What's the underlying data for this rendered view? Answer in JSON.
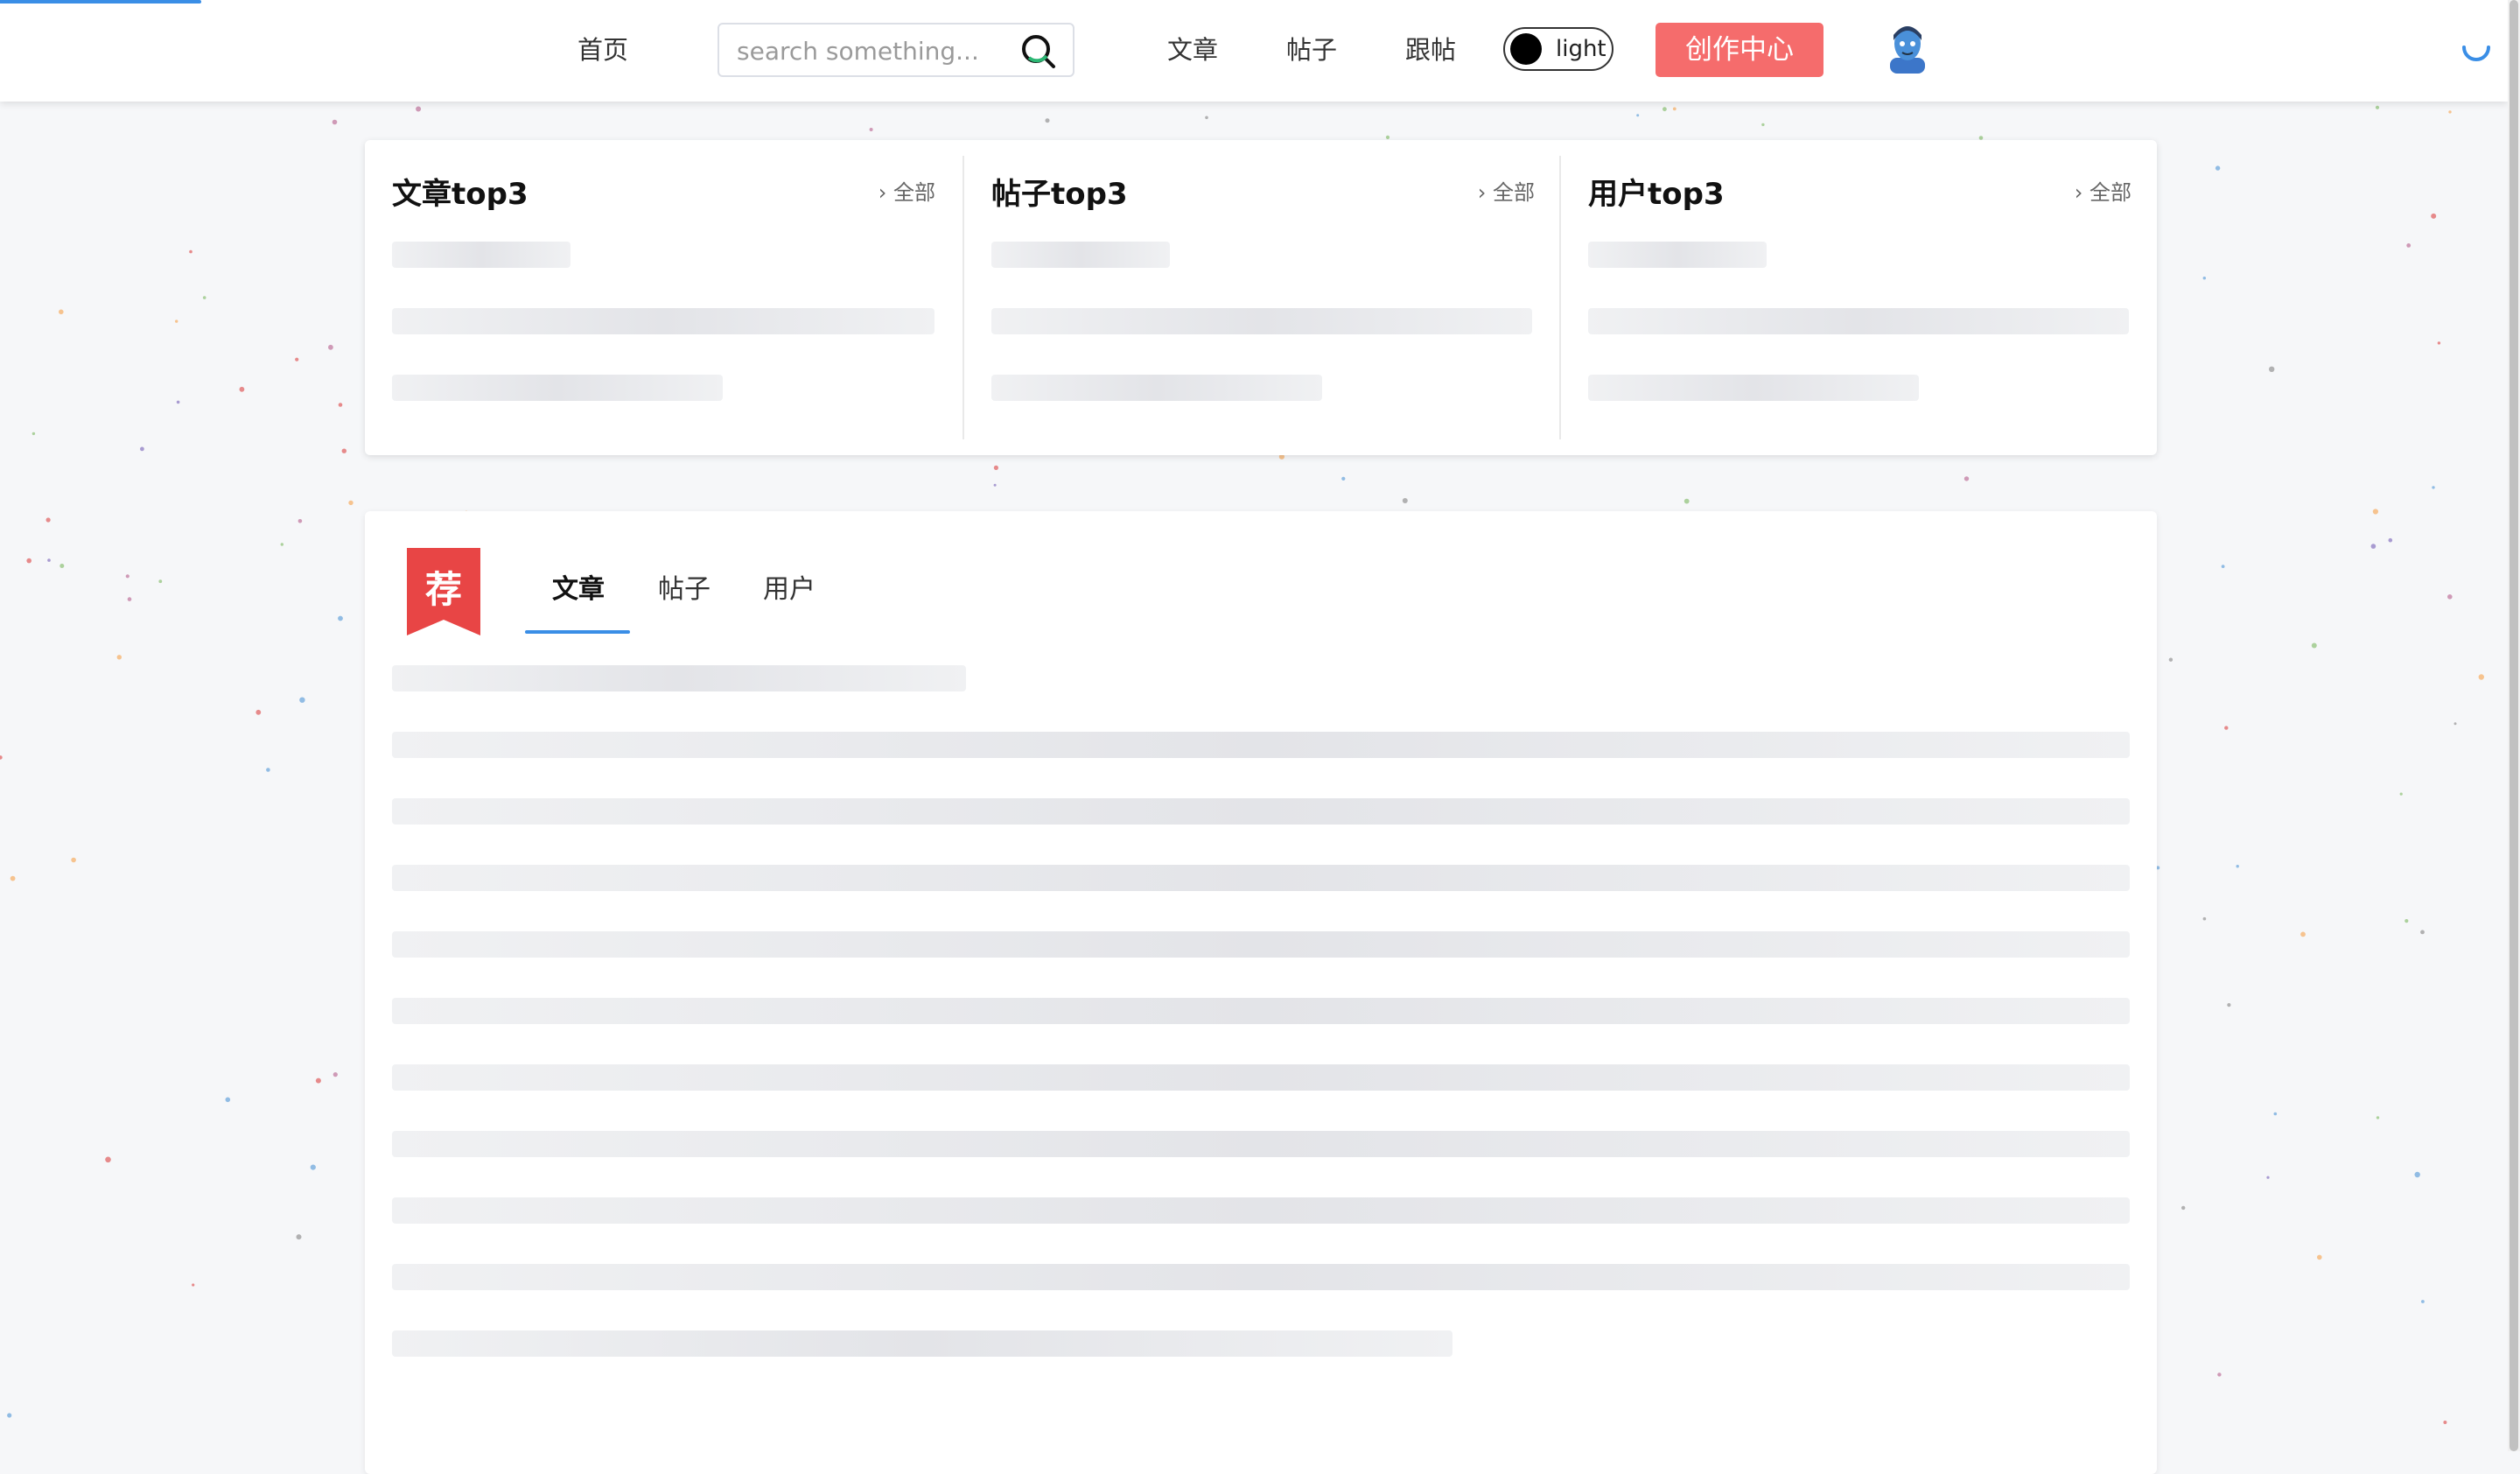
{
  "header": {
    "home": "首页",
    "search_placeholder": "search something...",
    "nav": [
      "文章",
      "帖子",
      "跟帖"
    ],
    "theme_label": "light",
    "create_button": "创作中心"
  },
  "top3": [
    {
      "title": "文章top3",
      "more": "全部"
    },
    {
      "title": "帖子top3",
      "more": "全部"
    },
    {
      "title": "用户top3",
      "more": "全部"
    }
  ],
  "recommend": {
    "badge": "荐",
    "tabs": [
      "文章",
      "帖子",
      "用户"
    ],
    "active_tab": 0
  },
  "colors": {
    "accent": "#3a8ee6",
    "create_button": "#f56c6c",
    "badge": "#e84545",
    "background": "#f6f7f9"
  }
}
